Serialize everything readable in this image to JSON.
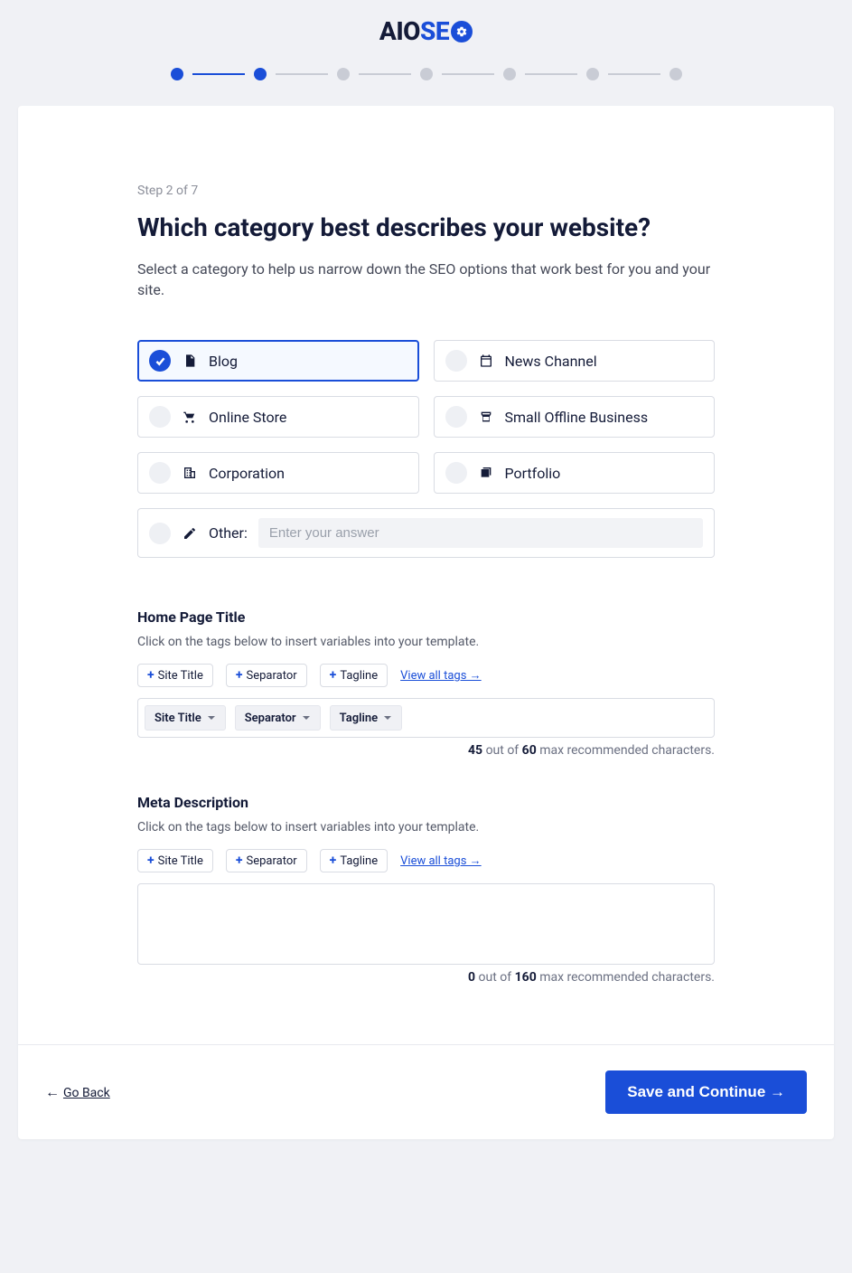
{
  "logo": {
    "aio": "AIO",
    "se": "SE"
  },
  "stepper": {
    "total": 7,
    "current": 2
  },
  "step_label": "Step 2 of 7",
  "title": "Which category best describes your website?",
  "subtitle": "Select a category to help us narrow down the SEO options that work best for you and your site.",
  "categories": [
    {
      "label": "Blog",
      "icon": "doc",
      "selected": true
    },
    {
      "label": "News Channel",
      "icon": "calendar",
      "selected": false
    },
    {
      "label": "Online Store",
      "icon": "cart",
      "selected": false
    },
    {
      "label": "Small Offline Business",
      "icon": "store",
      "selected": false
    },
    {
      "label": "Corporation",
      "icon": "building",
      "selected": false
    },
    {
      "label": "Portfolio",
      "icon": "stack",
      "selected": false
    }
  ],
  "other": {
    "label": "Other:",
    "placeholder": "Enter your answer"
  },
  "title_section": {
    "heading": "Home Page Title",
    "desc": "Click on the tags below to insert variables into your template.",
    "tags": [
      "Site Title",
      "Separator",
      "Tagline"
    ],
    "viewall": "View all tags →",
    "chips": [
      "Site Title",
      "Separator",
      "Tagline"
    ],
    "count_current": "45",
    "count_mid": " out of ",
    "count_max": "60",
    "count_end": " max recommended characters."
  },
  "meta_section": {
    "heading": "Meta Description",
    "desc": "Click on the tags below to insert variables into your template.",
    "tags": [
      "Site Title",
      "Separator",
      "Tagline"
    ],
    "viewall": "View all tags →",
    "count_current": "0",
    "count_mid": " out of ",
    "count_max": "160",
    "count_end": " max recommended characters."
  },
  "footer": {
    "back_arrow": "←",
    "back": "Go Back",
    "continue": "Save and Continue →"
  }
}
